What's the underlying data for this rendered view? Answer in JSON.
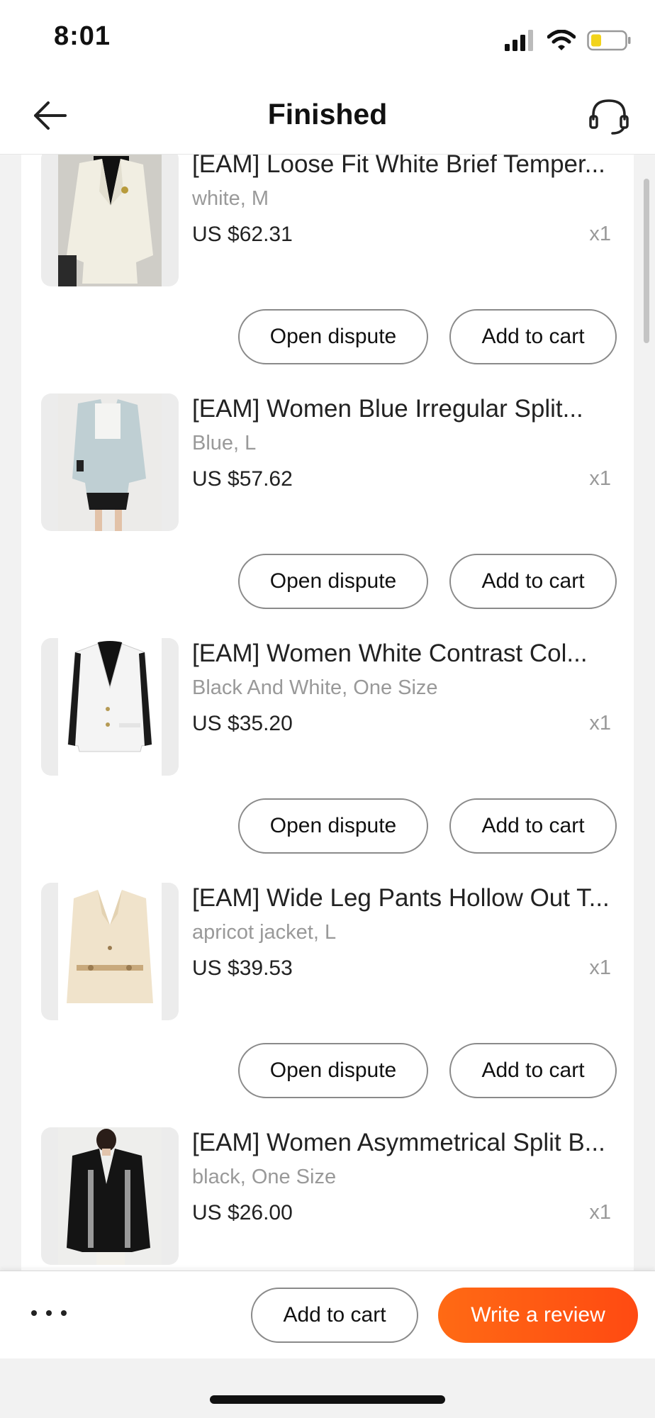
{
  "status_bar": {
    "time": "8:01"
  },
  "nav": {
    "title": "Finished"
  },
  "items": [
    {
      "title": "[EAM] Loose Fit White Brief Temper...",
      "variant": "white, M",
      "price": "US $62.31",
      "qty": "x1",
      "dispute_label": "Open dispute",
      "cart_label": "Add to cart"
    },
    {
      "title": "[EAM]  Women Blue Irregular Split...",
      "variant": "Blue, L",
      "price": "US $57.62",
      "qty": "x1",
      "dispute_label": "Open dispute",
      "cart_label": "Add to cart"
    },
    {
      "title": "[EAM]  Women White Contrast Col...",
      "variant": "Black And White, One Size",
      "price": "US $35.20",
      "qty": "x1",
      "dispute_label": "Open dispute",
      "cart_label": "Add to cart"
    },
    {
      "title": "[EAM] Wide Leg Pants Hollow Out T...",
      "variant": "apricot jacket, L",
      "price": "US $39.53",
      "qty": "x1",
      "dispute_label": "Open dispute",
      "cart_label": "Add to cart"
    },
    {
      "title": "[EAM] Women Asymmetrical Split B...",
      "variant": "black, One Size",
      "price": "US $26.00",
      "qty": "x1"
    }
  ],
  "bottom_bar": {
    "cart_label": "Add to cart",
    "review_label": "Write a review",
    "more_icon": "more-horizontal-icon"
  },
  "colors": {
    "accent": "#ff5a14",
    "muted_text": "#999999",
    "border": "#8a8a8a"
  }
}
